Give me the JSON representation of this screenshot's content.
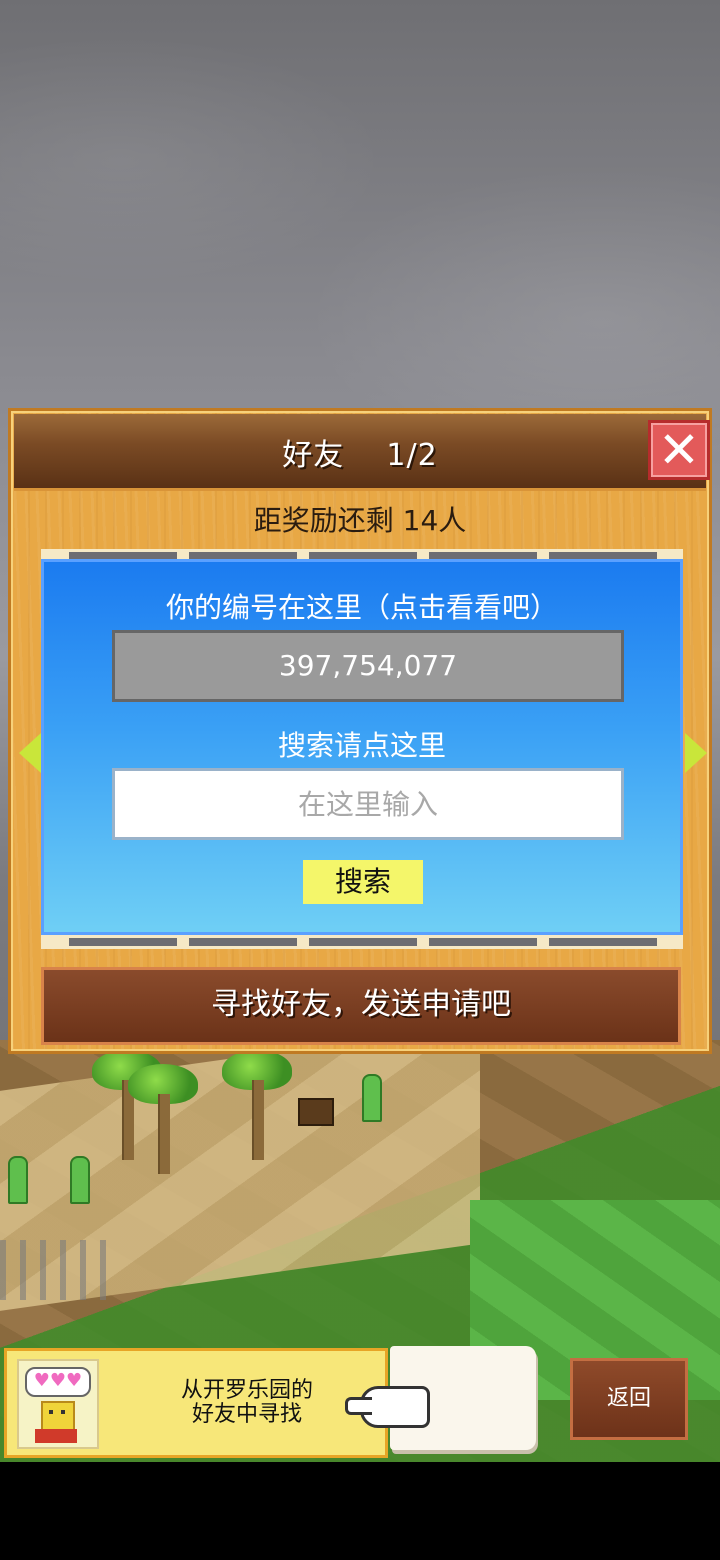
{
  "dialog": {
    "title": "好友    1/2",
    "close_icon": "close-x-icon",
    "reward_text": "距奖励还剩 14人",
    "id_prompt": "你的编号在这里（点击看看吧）",
    "player_id": "397,754,077",
    "search_prompt": "搜索请点这里",
    "search_placeholder": "在这里输入",
    "search_button": "搜索",
    "find_friends_button": "寻找好友，发送申请吧",
    "nav_left_icon": "arrow-left-icon",
    "nav_right_icon": "arrow-right-icon"
  },
  "bottom": {
    "card_line1": "从开罗乐园的",
    "card_line2": "好友中寻找",
    "hearts": "♥♥♥",
    "back_button": "返回"
  },
  "colors": {
    "panel": "#e8a845",
    "title_bar": "#7b4b25",
    "blue_box_top": "#1b7bf0",
    "blue_box_bottom": "#6fcff5",
    "search_button": "#f4f66a",
    "close_button": "#e35a5a"
  }
}
